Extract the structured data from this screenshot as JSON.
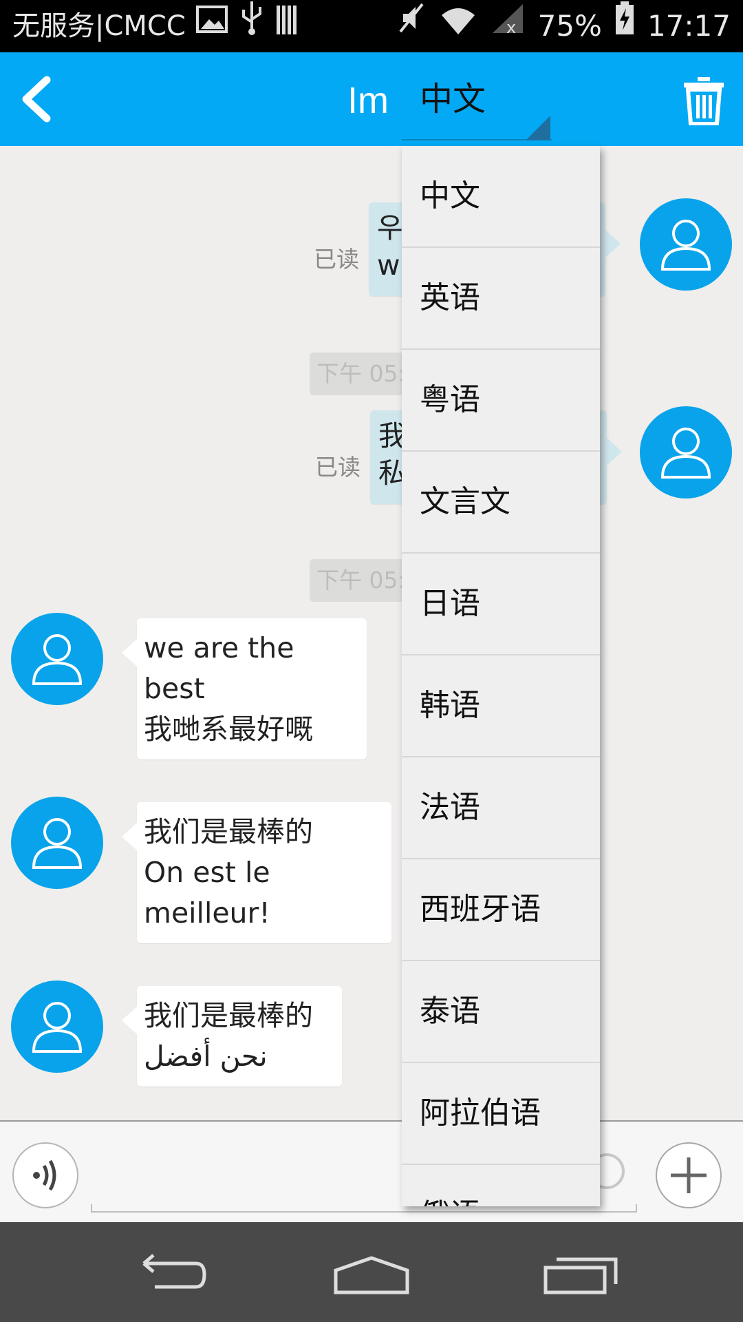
{
  "status_bar": {
    "carrier": "无服务|CMCC",
    "battery": "75%",
    "time": "17:17"
  },
  "header": {
    "title": "Im",
    "language_selected": "中文"
  },
  "messages": {
    "m1": {
      "read": "已读",
      "text_visible": "우\nw"
    },
    "time1": "下午 05:",
    "m2": {
      "read": "已读",
      "text_visible": "我\n私"
    },
    "time2": "下午 05:",
    "m3": {
      "text": "we are the best\n我哋系最好嘅"
    },
    "m4": {
      "text": "我们是最棒的\nOn est le meilleur!"
    },
    "m5": {
      "text": "我们是最棒的\nنحن أفضل"
    }
  },
  "language_dropdown": {
    "options": [
      "中文",
      "英语",
      "粤语",
      "文言文",
      "日语",
      "韩语",
      "法语",
      "西班牙语",
      "泰语",
      "阿拉伯语",
      "俄语"
    ]
  },
  "colors": {
    "header_bg": "#03a9f4",
    "avatar_bg": "#08a3ea",
    "my_bubble": "#cfe6ed",
    "nav_bg": "#494949"
  }
}
